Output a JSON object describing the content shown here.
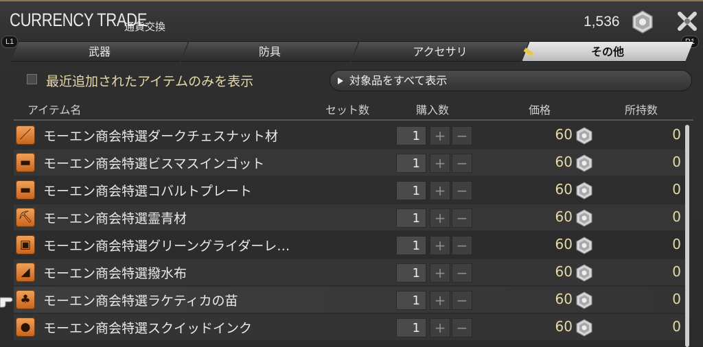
{
  "window": {
    "title": "CURRENCY TRADE",
    "subtitle": "通貨交換",
    "currency_amount": "1,536",
    "currency_icon": "scrip-icon",
    "close_icon": "close-icon",
    "shoulder_left": "L1",
    "shoulder_right": "R1"
  },
  "tabs": [
    {
      "label": "武器",
      "active": false
    },
    {
      "label": "防具",
      "active": false
    },
    {
      "label": "アクセサリ",
      "active": false
    },
    {
      "label": "その他",
      "active": true
    }
  ],
  "filter": {
    "checkbox_label": "最近追加されたアイテムのみを表示",
    "checked": false,
    "show_all_label": "対象品をすべて表示"
  },
  "columns": {
    "item": "アイテム名",
    "sets": "セット数",
    "buy": "購入数",
    "price": "価格",
    "owned": "所持数"
  },
  "items": [
    {
      "name": "モーエン商会特選ダークチェスナット材",
      "icon": "lumber-icon",
      "glyph": "／",
      "qty": "1",
      "plus": "+",
      "minus": "−",
      "price": "60",
      "owned": "0"
    },
    {
      "name": "モーエン商会特選ビスマスインゴット",
      "icon": "anvil-icon",
      "glyph": "▬",
      "qty": "1",
      "plus": "+",
      "minus": "−",
      "price": "60",
      "owned": "0"
    },
    {
      "name": "モーエン商会特選コバルトプレート",
      "icon": "anvil-icon",
      "glyph": "▬",
      "qty": "1",
      "plus": "+",
      "minus": "−",
      "price": "60",
      "owned": "0"
    },
    {
      "name": "モーエン商会特選霊青材",
      "icon": "pickaxe-icon",
      "glyph": "⛏",
      "qty": "1",
      "plus": "+",
      "minus": "−",
      "price": "60",
      "owned": "0"
    },
    {
      "name": "モーエン商会特選グリーングライダーレ…",
      "icon": "hide-icon",
      "glyph": "▣",
      "qty": "1",
      "plus": "+",
      "minus": "−",
      "price": "60",
      "owned": "0"
    },
    {
      "name": "モーエン商会特選撥水布",
      "icon": "cloth-icon",
      "glyph": "◢",
      "qty": "1",
      "plus": "+",
      "minus": "−",
      "price": "60",
      "owned": "0"
    },
    {
      "name": "モーエン商会特選ラケティカの苗",
      "icon": "sapling-icon",
      "glyph": "♣",
      "qty": "1",
      "plus": "+",
      "minus": "−",
      "price": "60",
      "owned": "0"
    },
    {
      "name": "モーエン商会特選スクイッドインク",
      "icon": "ink-icon",
      "glyph": "●",
      "qty": "1",
      "plus": "+",
      "minus": "−",
      "price": "60",
      "owned": "0"
    }
  ],
  "highlighted_row": 6,
  "colors": {
    "accent_gold": "#e6d9a6",
    "active_tab": "#e9e9e9",
    "icon_orange": "#e58a3a"
  }
}
